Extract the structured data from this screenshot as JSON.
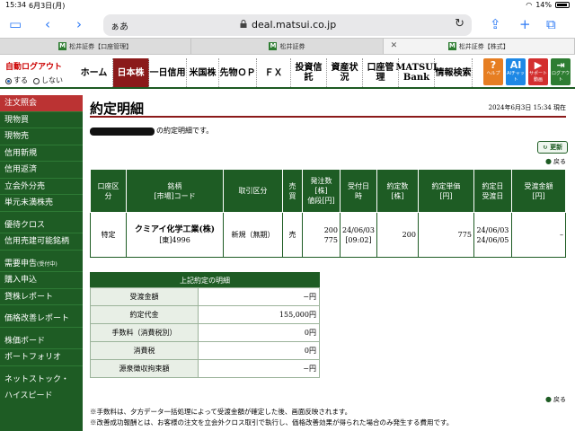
{
  "status": {
    "time": "15:34",
    "date": "6月3日(月)",
    "battery": "14%"
  },
  "browser": {
    "aa": "ぁあ",
    "url": "deal.matsui.co.jp",
    "tabs": [
      {
        "label": "松井証券【口座管理】",
        "active": false
      },
      {
        "label": "松井証券",
        "active": false
      },
      {
        "label": "松井証券【株式】",
        "active": true
      }
    ]
  },
  "header": {
    "auto_logout": "自動ログアウト",
    "on": "する",
    "off": "しない",
    "nav": [
      "ホーム",
      "日本株",
      "一日信用",
      "米国株",
      "先物ＯＰ",
      "ＦＸ",
      "投資信託",
      "資産状況",
      "口座管理",
      "MATSUI Bank",
      "情報検索"
    ],
    "icons": [
      {
        "name": "ヘルプ",
        "glyph": "?",
        "color": "#e67e22"
      },
      {
        "name": "AIチャット",
        "glyph": "AI",
        "color": "#1e88e5"
      },
      {
        "name": "サポート動画",
        "glyph": "▶",
        "color": "#d32f2f"
      },
      {
        "name": "ログアウト",
        "glyph": "⇥",
        "color": "#2e7d32"
      }
    ]
  },
  "sidebar": [
    "注文照会",
    "現物買",
    "現物売",
    "信用新規",
    "信用返済",
    "立会外分売",
    "単元未満株売",
    "",
    "優待クロス",
    "信用売建可能銘柄",
    "",
    "需要申告",
    "購入申込",
    "貸株レポート",
    "",
    "価格改善レポート",
    "",
    "株価ボード",
    "ポートフォリオ",
    "",
    "ネットストック・",
    "ハイスピード"
  ],
  "sidebar_note": "(受付中)",
  "main": {
    "title": "約定明細",
    "timestamp": "2024年6月3日 15:34 現在",
    "message": "の約定明細です。",
    "refresh": "更新",
    "back": "戻る"
  },
  "order_table": {
    "headers": [
      "口座区分",
      "銘柄\n[市場]コード",
      "取引区分",
      "売買",
      "発注数\n[株]\n値段[円]",
      "受付日時",
      "約定数\n[株]",
      "約定単価\n[円]",
      "約定日\n受渡日",
      "受渡金額\n[円]"
    ],
    "row": [
      "特定",
      "クミアイ化学工業(株)",
      "[東]4996",
      "新規（無期）",
      "売",
      "200",
      "775",
      "24/06/03",
      "[09:02]",
      "200",
      "775",
      "24/06/03",
      "24/06/05",
      "–"
    ]
  },
  "detail_table": {
    "caption": "上記約定の明細",
    "rows": [
      {
        "label": "受渡金額",
        "value": "−円"
      },
      {
        "label": "約定代金",
        "value": "155,000円"
      },
      {
        "label": "手数料（消費税別）",
        "value": "0円"
      },
      {
        "label": "消費税",
        "value": "0円"
      },
      {
        "label": "源泉徴収拘束額",
        "value": "−円"
      }
    ]
  },
  "notes": [
    "※手数料は、夕方データ一括処理によって受渡金額が確定した後、画面反映されます。",
    "※改善成功報酬とは、お客様の注文を立会外クロス取引で執行し、価格改善効果が得られた場合のみ発生する費用です。"
  ]
}
